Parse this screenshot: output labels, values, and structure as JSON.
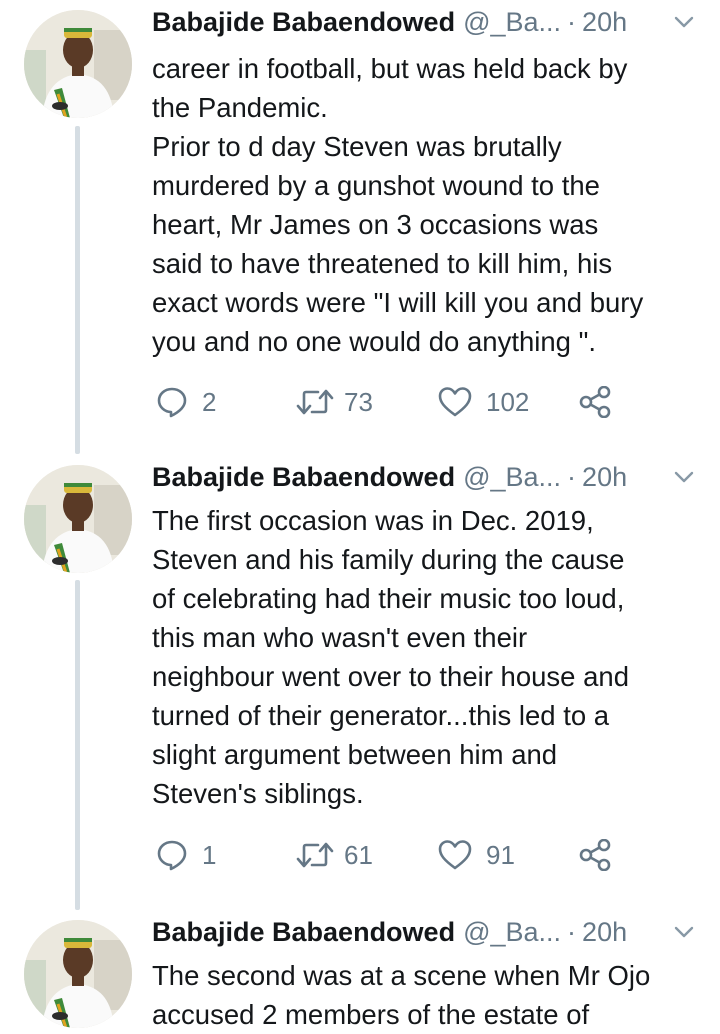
{
  "colors": {
    "text": "#14171a",
    "secondary": "#657786",
    "thread_line": "#d5dde3"
  },
  "tweets": [
    {
      "author": {
        "name": "Babajide Babaendowed",
        "handle": "@_Ba...",
        "separator": "·",
        "time": "20h"
      },
      "text": "career in football, but was held back by\nthe Pandemic.\nPrior to d day Steven was brutally\nmurdered by a gunshot wound to the\nheart, Mr James on 3 occasions was\nsaid to have threatened to kill him, his\nexact words were \"I will kill you and bury\nyou and no one would do anything \".",
      "replies": "2",
      "retweets": "73",
      "likes": "102",
      "icons": [
        "reply-icon",
        "retweet-icon",
        "like-icon",
        "share-icon",
        "chevron-down-icon"
      ]
    },
    {
      "author": {
        "name": "Babajide Babaendowed",
        "handle": "@_Ba...",
        "separator": "·",
        "time": "20h"
      },
      "text": "The first occasion was in Dec. 2019,\nSteven and his family during the cause\nof celebrating had their music too loud,\nthis man who wasn't even their\nneighbour went over to their house and\nturned of their generator...this led to a\nslight argument between him and\nSteven's siblings.",
      "replies": "1",
      "retweets": "61",
      "likes": "91",
      "icons": [
        "reply-icon",
        "retweet-icon",
        "like-icon",
        "share-icon",
        "chevron-down-icon"
      ]
    },
    {
      "author": {
        "name": "Babajide Babaendowed",
        "handle": "@_Ba...",
        "separator": "·",
        "time": "20h"
      },
      "text": "The second was at a scene when Mr Ojo\naccused 2 members of the estate of",
      "icons": [
        "chevron-down-icon"
      ]
    }
  ]
}
